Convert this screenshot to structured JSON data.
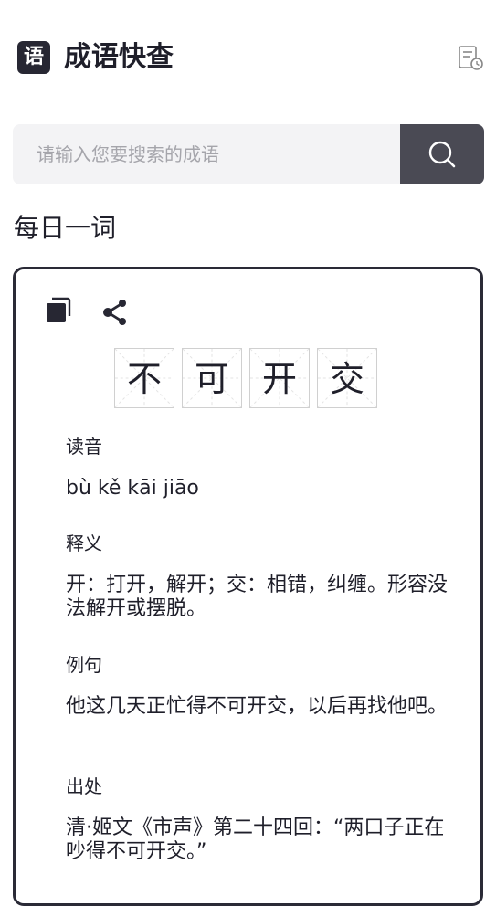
{
  "header": {
    "logo_char": "语",
    "title": "成语快查"
  },
  "search": {
    "placeholder": "请输入您要搜索的成语",
    "value": ""
  },
  "daily": {
    "section_title": "每日一词",
    "idiom_chars": [
      "不",
      "可",
      "开",
      "交"
    ],
    "fields": [
      {
        "label": "读音",
        "value": "bù kě kāi jiāo"
      },
      {
        "label": "释义",
        "value": "开：打开，解开；交：相错，纠缠。形容没法解开或摆脱。"
      },
      {
        "label": "例句",
        "value": "他这几天正忙得不可开交，以后再找他吧。"
      },
      {
        "label": "出处",
        "value": "清·姬文《市声》第二十四回：“两口子正在吵得不可开交。”"
      }
    ]
  },
  "icons": {
    "history": "history-icon",
    "search": "search-icon",
    "copy": "copy-icon",
    "share": "share-icon"
  },
  "colors": {
    "dark": "#272733",
    "search_button": "#4a4a54",
    "search_bg": "#f3f3f5",
    "placeholder": "#a5a5ab"
  }
}
